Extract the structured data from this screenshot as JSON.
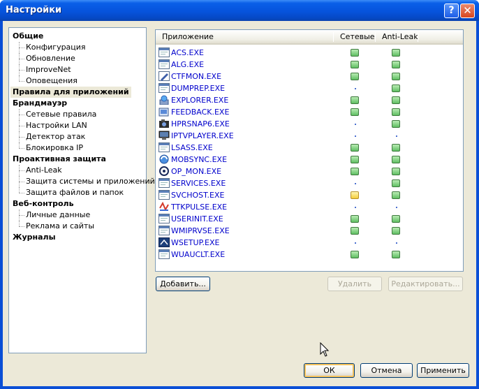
{
  "window": {
    "title": "Настройки",
    "help_label": "?",
    "close_label": "✕"
  },
  "nav": {
    "items": [
      {
        "label": "Общие",
        "level": 0
      },
      {
        "label": "Конфигурация",
        "level": 1
      },
      {
        "label": "Обновление",
        "level": 1
      },
      {
        "label": "ImproveNet",
        "level": 1
      },
      {
        "label": "Оповещения",
        "level": 1
      },
      {
        "label": "Правила для приложений",
        "level": 0,
        "selected": true
      },
      {
        "label": "Брандмауэр",
        "level": 0
      },
      {
        "label": "Сетевые правила",
        "level": 1
      },
      {
        "label": "Настройки LAN",
        "level": 1
      },
      {
        "label": "Детектор атак",
        "level": 1
      },
      {
        "label": "Блокировка IP",
        "level": 1
      },
      {
        "label": "Проактивная защита",
        "level": 0
      },
      {
        "label": "Anti-Leak",
        "level": 1
      },
      {
        "label": "Защита системы и приложений",
        "level": 1
      },
      {
        "label": "Защита файлов и папок",
        "level": 1
      },
      {
        "label": "Веб-контроль",
        "level": 0
      },
      {
        "label": "Личные данные",
        "level": 1
      },
      {
        "label": "Реклама и сайты",
        "level": 1
      },
      {
        "label": "Журналы",
        "level": 0
      }
    ]
  },
  "apps": {
    "columns": {
      "app": "Приложение",
      "net": "Сетевые",
      "leak": "Anti-Leak"
    },
    "rows": [
      {
        "name": "ACS.EXE",
        "icon": "window-icon",
        "net": "green",
        "leak": "green"
      },
      {
        "name": "ALG.EXE",
        "icon": "window-icon",
        "net": "green",
        "leak": "green"
      },
      {
        "name": "CTFMON.EXE",
        "icon": "pen-icon",
        "net": "green",
        "leak": "green"
      },
      {
        "name": "DUMPREP.EXE",
        "icon": "window-icon",
        "net": "none",
        "leak": "green"
      },
      {
        "name": "EXPLORER.EXE",
        "icon": "explorer-icon",
        "net": "green",
        "leak": "green"
      },
      {
        "name": "FEEDBACK.EXE",
        "icon": "feedback-icon",
        "net": "green",
        "leak": "green"
      },
      {
        "name": "HPRSNAP6.EXE",
        "icon": "camera-icon",
        "net": "none",
        "leak": "green"
      },
      {
        "name": "IPTVPLAYER.EXE",
        "icon": "monitor-icon",
        "net": "none",
        "leak": "none"
      },
      {
        "name": "LSASS.EXE",
        "icon": "window-icon",
        "net": "green",
        "leak": "green"
      },
      {
        "name": "MOBSYNC.EXE",
        "icon": "sync-icon",
        "net": "green",
        "leak": "green"
      },
      {
        "name": "OP_MON.EXE",
        "icon": "opmon-icon",
        "net": "green",
        "leak": "green"
      },
      {
        "name": "SERVICES.EXE",
        "icon": "window-icon",
        "net": "none",
        "leak": "green"
      },
      {
        "name": "SVCHOST.EXE",
        "icon": "window-icon",
        "net": "yellow",
        "leak": "green"
      },
      {
        "name": "TTKPULSE.EXE",
        "icon": "pulse-icon",
        "net": "none",
        "leak": "none"
      },
      {
        "name": "USERINIT.EXE",
        "icon": "window-icon",
        "net": "green",
        "leak": "green"
      },
      {
        "name": "WMIPRVSE.EXE",
        "icon": "window-icon",
        "net": "green",
        "leak": "green"
      },
      {
        "name": "WSETUP.EXE",
        "icon": "setup-icon",
        "net": "none",
        "leak": "none"
      },
      {
        "name": "WUAUCLT.EXE",
        "icon": "window-icon",
        "net": "green",
        "leak": "green"
      }
    ]
  },
  "buttons": {
    "add": "Добавить...",
    "delete": "Удалить",
    "edit": "Редактировать...",
    "ok": "ОК",
    "cancel": "Отмена",
    "apply": "Применить"
  },
  "colors": {
    "allow": "#5fbf62",
    "ask": "#f4cc3c",
    "link": "#0000cc"
  }
}
